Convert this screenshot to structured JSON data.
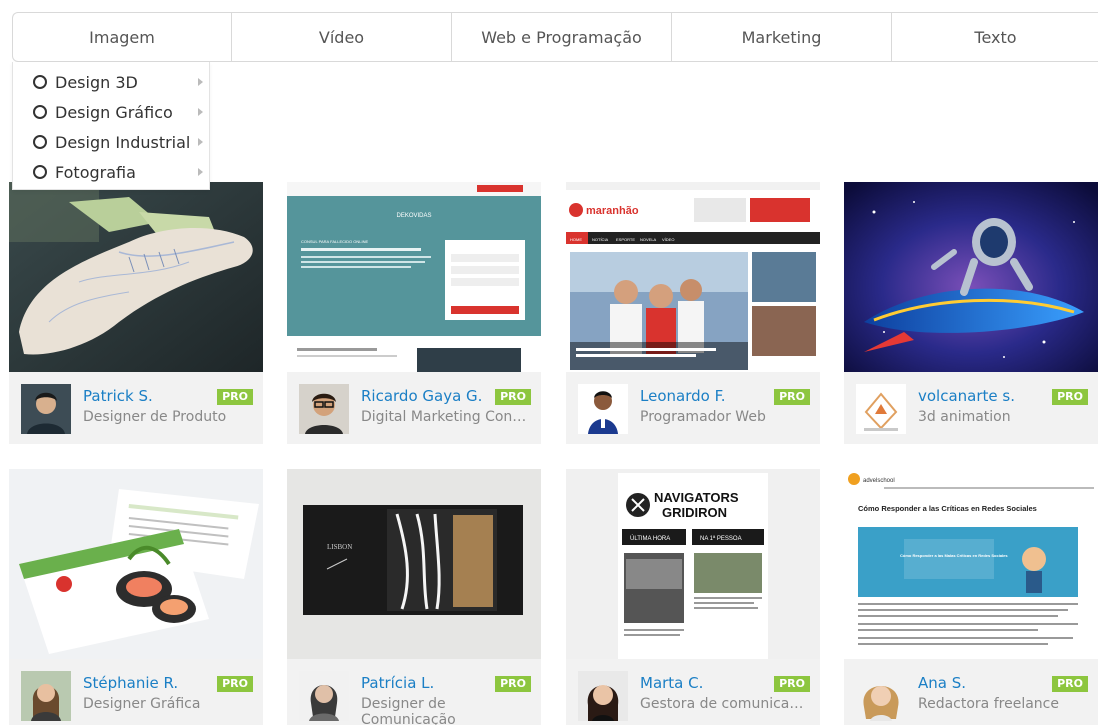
{
  "tabs": [
    {
      "label": "Imagem"
    },
    {
      "label": "Vídeo"
    },
    {
      "label": "Web e Programação"
    },
    {
      "label": "Marketing"
    },
    {
      "label": "Texto"
    }
  ],
  "dropdown": {
    "items": [
      {
        "label": "Design 3D"
      },
      {
        "label": "Design Gráfico"
      },
      {
        "label": "Design Industrial"
      },
      {
        "label": "Fotografia"
      }
    ]
  },
  "badge": "PRO",
  "cards": [
    {
      "name": "Patrick S.",
      "role": "Designer de Produto"
    },
    {
      "name": "Ricardo Gaya G.",
      "role": "Digital Marketing Consu..."
    },
    {
      "name": "Leonardo F.",
      "role": "Programador Web"
    },
    {
      "name": "volcanarte s.",
      "role": "3d animation"
    },
    {
      "name": "Stéphanie R.",
      "role": "Designer Gráfica"
    },
    {
      "name": "Patrícia L.",
      "role": "Designer de Comunicação"
    },
    {
      "name": "Marta C.",
      "role": "Gestora de comunicação ..."
    },
    {
      "name": "Ana S.",
      "role": "Redactora freelance"
    }
  ],
  "thumb_text": {
    "dekovidas_title": "DEKOVIDAS",
    "dekovidas_sub": "CONSUL PARA FALLECIDO ONLINE",
    "maranhao_logo": "maranhão",
    "maranhao_menu": [
      "HOME",
      "NOTÍCIA",
      "ESPORTE",
      "NOVELA",
      "VÍDEO"
    ],
    "navigators_title": "NAVIGATORS",
    "navigators_sub": "GRIDIRON",
    "navigators_tab1": "ÚLTIMA HORA",
    "navigators_tab2": "NA 1ª PESSOA",
    "advelschool_logo": "advelschool",
    "advelschool_headline": "Cómo Responder a las Críticas en Redes Sociales",
    "advelschool_banner": "Cómo Responder a las Malas Críticas en Redes Sociales",
    "lisbon": "LISBON"
  },
  "colors": {
    "accent": "#1b7fc5",
    "pro_badge": "#8dc63f",
    "card_bg": "#f2f2f2"
  }
}
